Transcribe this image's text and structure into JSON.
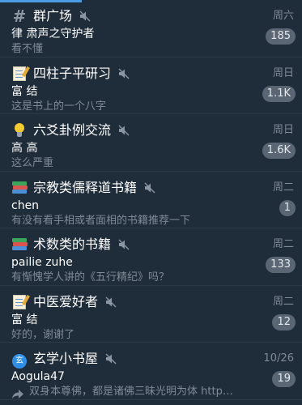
{
  "progress": 0.27,
  "chats": [
    {
      "icon": "hash-icon",
      "title": "群广场",
      "muted": true,
      "date": "周六",
      "sender": "律 肃声之守护者",
      "preview": "看不懂",
      "unread": "185",
      "forwarded": false
    },
    {
      "icon": "memo-icon",
      "title": "四柱子平研习",
      "muted": true,
      "date": "周日",
      "sender": "富 结",
      "preview": "这是书上的一个八字",
      "unread": "1.1K",
      "forwarded": false
    },
    {
      "icon": "light-bulb-icon",
      "title": "六爻卦例交流",
      "muted": true,
      "date": "周日",
      "sender": "高 高",
      "preview": "这么严重",
      "unread": "1.6K",
      "forwarded": false
    },
    {
      "icon": "books-icon",
      "title": "宗教类儒释道书籍",
      "muted": true,
      "date": "周二",
      "sender": "chen",
      "preview": "有没有看手相或者面相的书籍推荐一下",
      "unread": "1",
      "forwarded": false
    },
    {
      "icon": "books-icon",
      "title": "术数类的书籍",
      "muted": true,
      "date": "周二",
      "sender": "pailie zuhe",
      "preview": "有惭愧学人讲的《五行精纪》吗？",
      "unread": "133",
      "forwarded": false
    },
    {
      "icon": "memo-icon",
      "title": "中医爱好者",
      "muted": true,
      "date": "周二",
      "sender": "富 结",
      "preview": "好的，谢谢了",
      "unread": "12",
      "forwarded": false
    },
    {
      "icon": "xuan-badge-icon",
      "icon_text": "玄",
      "title": "玄学小书屋",
      "muted": true,
      "date": "10/26",
      "sender": "Aogula47",
      "preview": "双身本尊佛，都是诸佛三昧光明为体 http…",
      "unread": "19",
      "forwarded": true
    }
  ]
}
